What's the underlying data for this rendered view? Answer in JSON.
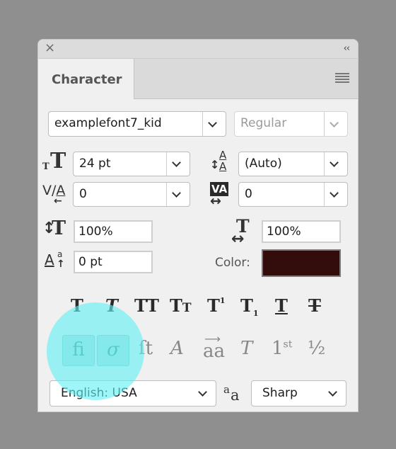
{
  "panel": {
    "close_icon": "×",
    "collapse_icon": "‹‹",
    "tab_label": "Character"
  },
  "font": {
    "family": "examplefont7_kid",
    "style": "Regular"
  },
  "metrics": {
    "size": "24 pt",
    "leading": "(Auto)",
    "kerning": "0",
    "tracking": "0",
    "vertical_scale": "100%",
    "horizontal_scale": "100%",
    "baseline_shift": "0 pt",
    "color_label": "Color:",
    "color": "#330c0c"
  },
  "type_style_buttons": [
    {
      "name": "faux-bold",
      "glyph": "T"
    },
    {
      "name": "faux-italic",
      "glyph": "T"
    },
    {
      "name": "all-caps",
      "glyph": "TT"
    },
    {
      "name": "small-caps",
      "glyph": "Tт"
    },
    {
      "name": "superscript",
      "glyph": "T¹"
    },
    {
      "name": "subscript",
      "glyph": "T₁"
    },
    {
      "name": "underline",
      "glyph": "T"
    },
    {
      "name": "strikethrough",
      "glyph": "T"
    }
  ],
  "opentype_buttons": [
    {
      "name": "standard-ligatures",
      "glyph": "ﬁ",
      "active": true
    },
    {
      "name": "contextual-alternates",
      "glyph": "σ",
      "active": true
    },
    {
      "name": "discretionary-ligatures",
      "glyph": "ﬅ",
      "active": false
    },
    {
      "name": "swash",
      "glyph": "𝒜",
      "active": false
    },
    {
      "name": "stylistic-alternates",
      "glyph": "aa",
      "active": false
    },
    {
      "name": "titling-alternates",
      "glyph": "𝕋",
      "active": false
    },
    {
      "name": "ordinals",
      "glyph": "1ˢᵗ",
      "active": false
    },
    {
      "name": "fractions",
      "glyph": "½",
      "active": false
    }
  ],
  "language": "English: USA",
  "antialias_icon": "ªa",
  "antialias": "Sharp"
}
